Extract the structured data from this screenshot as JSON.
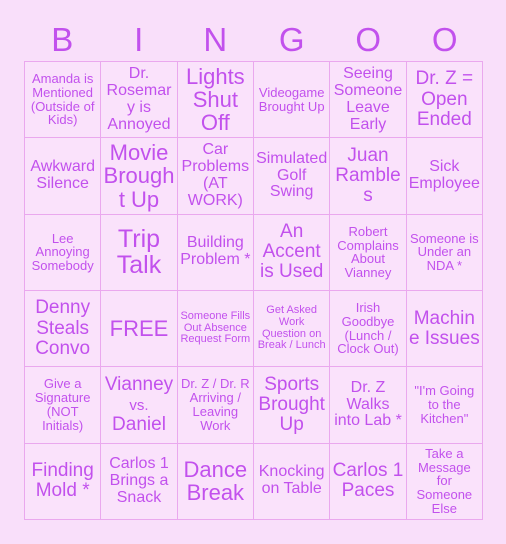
{
  "colors": {
    "page_background": "#f9dffa",
    "cell_background": "#fae2fb",
    "grid_line": "#eaa8ee",
    "text": "#c251ed"
  },
  "header": {
    "letters": [
      "B",
      "I",
      "N",
      "G",
      "O",
      "O"
    ]
  },
  "grid": {
    "columns": 6,
    "rows": 6,
    "cells": [
      [
        {
          "text": "Amanda is Mentioned (Outside of Kids)",
          "size": "fs-sm",
          "free": false
        },
        {
          "text": "Dr. Rosemary is Annoyed",
          "size": "fs-md",
          "free": false
        },
        {
          "text": "Lights Shut Off",
          "size": "fs-xl",
          "free": false
        },
        {
          "text": "Videogame Brought Up",
          "size": "fs-sm",
          "free": false
        },
        {
          "text": "Seeing Someone Leave Early",
          "size": "fs-md",
          "free": false
        },
        {
          "text": "Dr. Z = Open Ended",
          "size": "fs-lg",
          "free": false
        }
      ],
      [
        {
          "text": "Awkward Silence",
          "size": "fs-md",
          "free": false
        },
        {
          "text": "Movie Brought Up",
          "size": "fs-xl",
          "free": false
        },
        {
          "text": "Car Problems (AT WORK)",
          "size": "fs-md",
          "free": false
        },
        {
          "text": "Simulated Golf Swing",
          "size": "fs-md",
          "free": false
        },
        {
          "text": "Juan Rambles",
          "size": "fs-lg",
          "free": false
        },
        {
          "text": "Sick Employee",
          "size": "fs-md",
          "free": false
        }
      ],
      [
        {
          "text": "Lee Annoying Somebody",
          "size": "fs-sm",
          "free": false
        },
        {
          "text": "Trip Talk",
          "size": "fs-xxl",
          "free": false
        },
        {
          "text": "Building Problem *",
          "size": "fs-md",
          "free": false
        },
        {
          "text": "An Accent is Used",
          "size": "fs-lg",
          "free": false
        },
        {
          "text": "Robert Complains About Vianney",
          "size": "fs-sm",
          "free": false
        },
        {
          "text": "Someone is Under an NDA *",
          "size": "fs-sm",
          "free": false
        }
      ],
      [
        {
          "text": "Denny Steals Convo",
          "size": "fs-lg",
          "free": false
        },
        {
          "text": "FREE",
          "size": "fs-xl",
          "free": true
        },
        {
          "text": "Someone Fills Out Absence Request Form",
          "size": "fs-xs",
          "free": false
        },
        {
          "text": "Get Asked Work Question on Break / Lunch",
          "size": "fs-xs",
          "free": false
        },
        {
          "text": "Irish Goodbye (Lunch / Clock Out)",
          "size": "fs-sm",
          "free": false
        },
        {
          "text": "Machine Issues",
          "size": "fs-lg",
          "free": false
        }
      ],
      [
        {
          "text": "Give a Signature (NOT Initials)",
          "size": "fs-sm",
          "free": false
        },
        {
          "text": "Vianney vs. Daniel",
          "size": "fs-lg",
          "free": false
        },
        {
          "text": "Dr. Z / Dr. R Arriving / Leaving Work",
          "size": "fs-sm",
          "free": false
        },
        {
          "text": "Sports Brought Up",
          "size": "fs-lg",
          "free": false
        },
        {
          "text": "Dr. Z Walks into Lab *",
          "size": "fs-md",
          "free": false
        },
        {
          "text": "\"I'm Going to the Kitchen\"",
          "size": "fs-sm",
          "free": false
        }
      ],
      [
        {
          "text": "Finding Mold *",
          "size": "fs-lg",
          "free": false
        },
        {
          "text": "Carlos 1 Brings a Snack",
          "size": "fs-md",
          "free": false
        },
        {
          "text": "Dance Break",
          "size": "fs-xl",
          "free": false
        },
        {
          "text": "Knocking on Table",
          "size": "fs-md",
          "free": false
        },
        {
          "text": "Carlos 1 Paces",
          "size": "fs-lg",
          "free": false
        },
        {
          "text": "Take a Message for Someone Else",
          "size": "fs-sm",
          "free": false
        }
      ]
    ]
  }
}
